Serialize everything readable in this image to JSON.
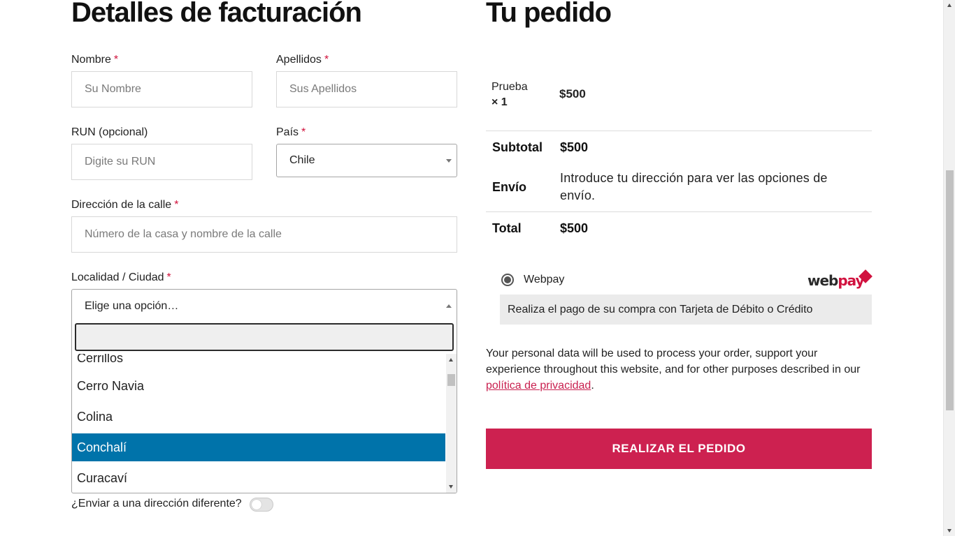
{
  "billing": {
    "title": "Detalles de facturación",
    "required_mark": "*",
    "first_name": {
      "label": "Nombre",
      "placeholder": "Su Nombre"
    },
    "last_name": {
      "label": "Apellidos",
      "placeholder": "Sus Apellidos"
    },
    "run": {
      "label": "RUN (opcional)",
      "placeholder": "Digite su RUN"
    },
    "country": {
      "label": "País",
      "value": "Chile"
    },
    "street": {
      "label": "Dirección de la calle",
      "placeholder": "Número de la casa y nombre de la calle"
    },
    "city": {
      "label": "Localidad / Ciudad",
      "value": "Elige una opción…",
      "search_value": "",
      "options": [
        "Cerrillos",
        "Cerro Navia",
        "Colina",
        "Conchalí",
        "Curacaví"
      ],
      "highlighted": "Conchalí"
    },
    "ship_different": {
      "label": "¿Enviar a una dirección diferente?",
      "enabled": false
    }
  },
  "order": {
    "title": "Tu pedido",
    "item": {
      "name": "Prueba",
      "qty": "× 1",
      "price": "$500"
    },
    "subtotal": {
      "label": "Subtotal",
      "value": "$500"
    },
    "shipping": {
      "label": "Envío",
      "value": "Introduce tu dirección para ver las opciones de envío."
    },
    "total": {
      "label": "Total",
      "value": "$500"
    },
    "payment": {
      "method": "Webpay",
      "selected": true,
      "logo_text_dark": "web",
      "logo_text_red": "pay",
      "description": "Realiza el pago de su compra con Tarjeta de Débito o Crédito"
    },
    "privacy_text": "Your personal data will be used to process your order, support your experience throughout this website, and for other purposes described in our ",
    "privacy_link": "política de privacidad",
    "privacy_end": ".",
    "place_order_label": "REALIZAR EL PEDIDO"
  },
  "colors": {
    "accent": "#cd2150",
    "highlight": "#0073aa",
    "required": "#d0113b"
  }
}
